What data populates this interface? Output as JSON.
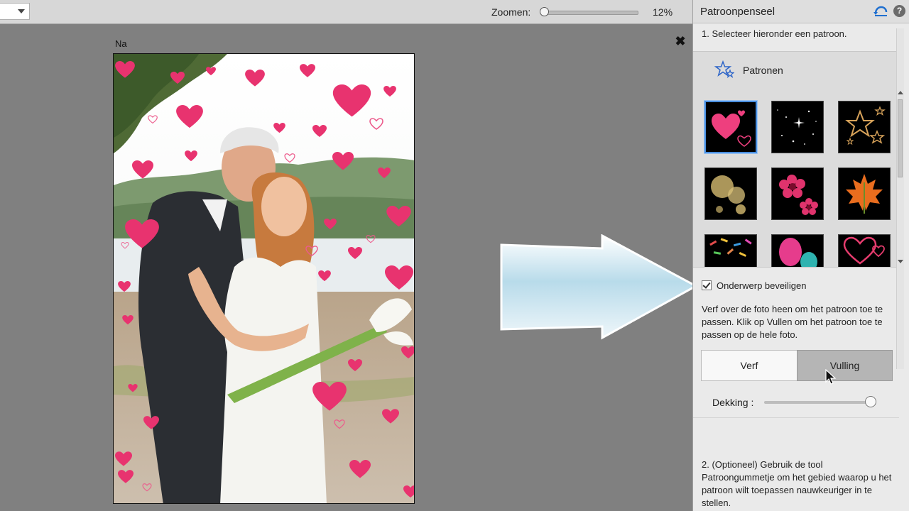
{
  "toolbar": {
    "zoom_label": "Zoomen:",
    "zoom_value": "12%",
    "zoom_fraction": 0.0
  },
  "document": {
    "view_label": "Na",
    "close_glyph": "✖"
  },
  "panel": {
    "title": "Patroonpenseel",
    "help_glyph": "?",
    "step1": "1. Selecteer hieronder een patroon.",
    "patterns_label": "Patronen",
    "patterns": [
      {
        "name": "hearts",
        "selected": true
      },
      {
        "name": "sparkles",
        "selected": false
      },
      {
        "name": "stars",
        "selected": false
      },
      {
        "name": "bokeh",
        "selected": false
      },
      {
        "name": "flowers",
        "selected": false
      },
      {
        "name": "leaf",
        "selected": false
      },
      {
        "name": "confetti",
        "selected": false
      },
      {
        "name": "balloons",
        "selected": false
      },
      {
        "name": "heart-outlines",
        "selected": false
      }
    ],
    "protect_subject_label": "Onderwerp beveiligen",
    "protect_subject_checked": true,
    "description": "Verf over de foto heen om het patroon toe te passen. Klik op Vullen om het patroon toe te passen op de hele foto.",
    "paint_button": "Verf",
    "fill_button": "Vulling",
    "opacity_label": "Dekking :",
    "opacity_fraction": 1.0,
    "step2": "2. (Optioneel) Gebruik de tool Patroongummetje om het gebied waarop u het patroon wilt toepassen nauwkeuriger in te stellen."
  },
  "colors": {
    "accent": "#4a8fe0",
    "heart_pink": "#e8336f"
  }
}
